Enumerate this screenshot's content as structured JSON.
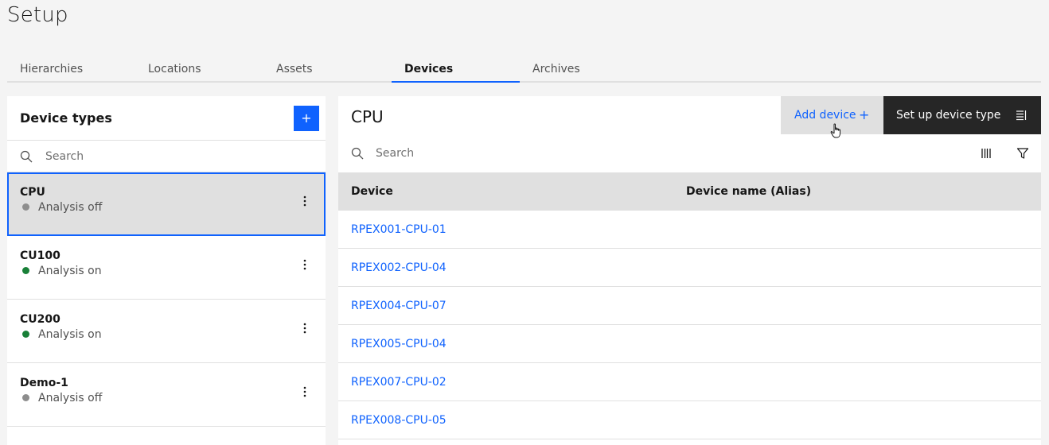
{
  "page": {
    "title": "Setup"
  },
  "tabs": [
    {
      "label": "Hierarchies"
    },
    {
      "label": "Locations"
    },
    {
      "label": "Assets"
    },
    {
      "label": "Devices",
      "active": true
    },
    {
      "label": "Archives"
    }
  ],
  "left_panel": {
    "title": "Device types",
    "add_button_label": "+",
    "search_placeholder": "Search",
    "device_types": [
      {
        "name": "CPU",
        "status": "Analysis off",
        "status_color": "#8d8d8d",
        "selected": true
      },
      {
        "name": "CU100",
        "status": "Analysis on",
        "status_color": "#198038"
      },
      {
        "name": "CU200",
        "status": "Analysis on",
        "status_color": "#198038"
      },
      {
        "name": "Demo-1",
        "status": "Analysis off",
        "status_color": "#8d8d8d"
      }
    ]
  },
  "right_panel": {
    "title": "CPU",
    "add_device_label": "Add device",
    "add_device_icon": "+",
    "setup_type_label": "Set up device type",
    "search_placeholder": "Search",
    "columns": {
      "device": "Device",
      "alias": "Device name (Alias)"
    },
    "devices": [
      {
        "device": "RPEX001-CPU-01",
        "alias": ""
      },
      {
        "device": "RPEX002-CPU-04",
        "alias": ""
      },
      {
        "device": "RPEX004-CPU-07",
        "alias": ""
      },
      {
        "device": "RPEX005-CPU-04",
        "alias": ""
      },
      {
        "device": "RPEX007-CPU-02",
        "alias": ""
      },
      {
        "device": "RPEX008-CPU-05",
        "alias": ""
      }
    ]
  },
  "colors": {
    "accent": "#0f62fe",
    "status_on": "#198038",
    "status_off": "#8d8d8d",
    "dark_button": "#262626"
  }
}
